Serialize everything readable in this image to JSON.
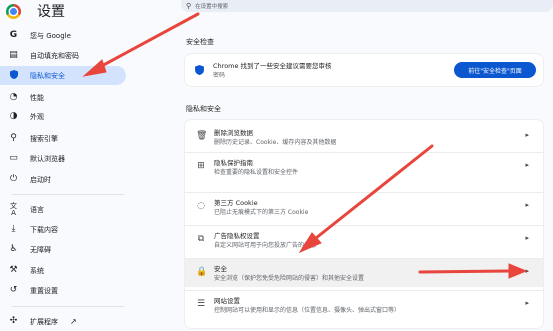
{
  "app": {
    "title": "设置"
  },
  "search": {
    "placeholder": "在设置中搜索"
  },
  "sidebar": {
    "items": [
      {
        "label": "您与 Google",
        "icon": "google-icon"
      },
      {
        "label": "自动填充和密码",
        "icon": "clipboard-icon"
      },
      {
        "label": "隐私和安全",
        "icon": "shield-icon",
        "active": true
      },
      {
        "label": "性能",
        "icon": "speedometer-icon"
      },
      {
        "label": "外观",
        "icon": "palette-icon"
      },
      {
        "label": "搜索引擎",
        "icon": "search-icon"
      },
      {
        "label": "默认浏览器",
        "icon": "browser-window-icon"
      },
      {
        "label": "启动时",
        "icon": "power-icon"
      },
      {
        "label": "语言",
        "icon": "translate-icon"
      },
      {
        "label": "下载内容",
        "icon": "download-icon"
      },
      {
        "label": "无障碍",
        "icon": "accessibility-icon"
      },
      {
        "label": "系统",
        "icon": "wrench-icon"
      },
      {
        "label": "重置设置",
        "icon": "reset-icon"
      }
    ],
    "extensions": {
      "label": "扩展程序",
      "icon": "external-link-icon"
    }
  },
  "safety_check": {
    "heading": "安全检查",
    "text": "Chrome 找到了一些安全建议需要您审核",
    "sub": "密码",
    "button": "前往\"安全检查\"页面"
  },
  "privacy": {
    "heading": "隐私和安全",
    "rows": [
      {
        "title": "删除浏览数据",
        "sub": "删除历史记录、Cookie、缓存内容及其他数据",
        "icon": "trash-icon",
        "action": "arrow"
      },
      {
        "title": "隐私保护指南",
        "sub": "检查重要的隐私设置和安全控件",
        "icon": "guide-icon",
        "action": "arrow"
      },
      {
        "title": "第三方 Cookie",
        "sub": "已阻止无痕模式下的第三方 Cookie",
        "icon": "cookie-icon",
        "action": "arrow"
      },
      {
        "title": "广告隐私权设置",
        "sub": "自定义网站可用于向您投放广告的信息",
        "icon": "ad-privacy-icon",
        "action": "arrow"
      },
      {
        "title": "安全",
        "sub": "安全浏览（保护您免受危险网站的侵害）和其他安全设置",
        "icon": "lock-icon",
        "action": "arrow",
        "highlighted": true
      },
      {
        "title": "网站设置",
        "sub": "控制网站可以使用和显示的信息（位置信息、摄像头、弹出式窗口等）",
        "icon": "site-settings-icon",
        "action": "arrow"
      }
    ]
  },
  "colors": {
    "accent": "#0b57d0",
    "active_bg": "#d3e3fd",
    "annotation_arrow": "#e8453c"
  }
}
